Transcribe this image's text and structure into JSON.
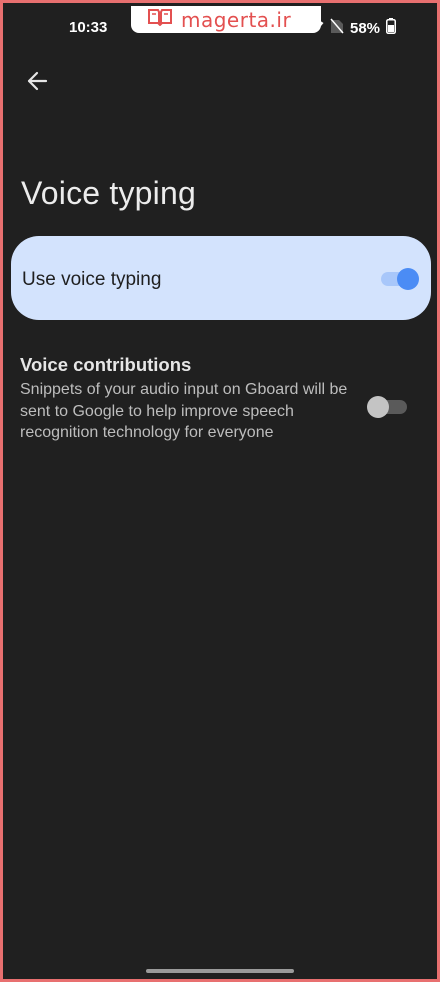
{
  "status_bar": {
    "time": "10:33",
    "battery": "58%",
    "icons": [
      "wifi-icon",
      "no-signal-icon",
      "battery-icon"
    ]
  },
  "watermark": {
    "text": "magerta.ir",
    "color": "#e35050"
  },
  "header": {
    "back_icon": "arrow-left-icon",
    "title": "Voice typing"
  },
  "main_toggle": {
    "label": "Use voice typing",
    "enabled": true,
    "accent": "#4b8cf5",
    "card_color": "#d3e3fd"
  },
  "voice_contributions": {
    "title": "Voice contributions",
    "description": "Snippets of your audio input on Gboard will be sent to Google to help improve speech recognition technology for everyone",
    "enabled": false
  }
}
